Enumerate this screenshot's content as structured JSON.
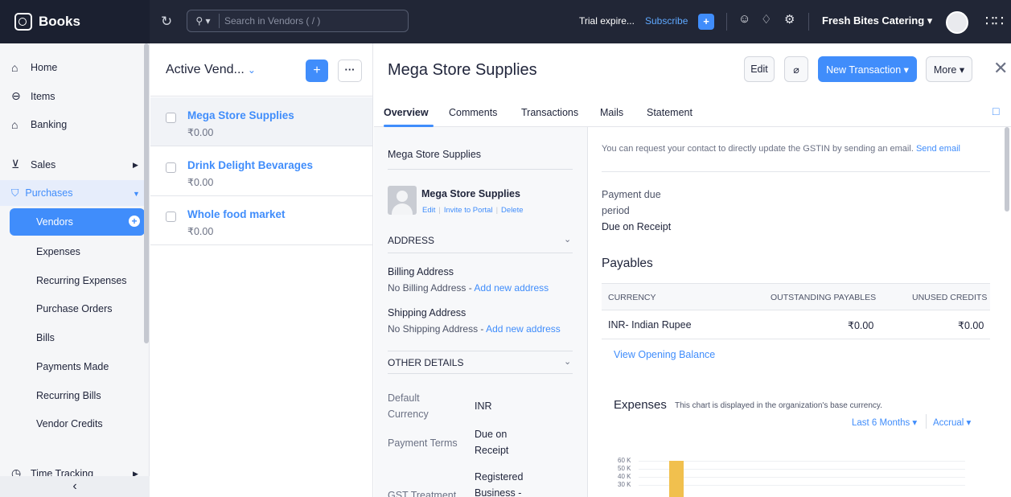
{
  "topbar": {
    "app_name": "Books",
    "search_placeholder": "Search in Vendors ( / )",
    "trial_text": "Trial expire...",
    "subscribe_label": "Subscribe",
    "org_name": "Fresh Bites Catering",
    "icons": [
      "books-logo-icon",
      "refresh-icon",
      "search-icon",
      "plus-icon",
      "users-icon",
      "bell-icon",
      "settings-icon",
      "app-grid-icon"
    ]
  },
  "sidebar": {
    "home": "Home",
    "items": "Items",
    "banking": "Banking",
    "sales": "Sales",
    "purchases": "Purchases",
    "vendors": "Vendors",
    "expenses": "Expenses",
    "recurring_expenses": "Recurring Expenses",
    "purchase_orders": "Purchase Orders",
    "bills": "Bills",
    "payments_made": "Payments Made",
    "recurring_bills": "Recurring Bills",
    "vendor_credits": "Vendor Credits",
    "time_tracking": "Time Tracking",
    "collapse": "‹"
  },
  "list": {
    "title": "Active Vend...",
    "vendors": [
      {
        "name": "Mega Store Supplies",
        "amount": "₹0.00"
      },
      {
        "name": "Drink Delight Bevarages",
        "amount": "₹0.00"
      },
      {
        "name": "Whole food market",
        "amount": "₹0.00"
      }
    ]
  },
  "detail": {
    "title": "Mega Store Supplies",
    "buttons": {
      "edit": "Edit",
      "attach": "⌀",
      "new_transaction": "New Transaction ▾",
      "more": "More ▾"
    },
    "tabs": [
      "Overview",
      "Comments",
      "Transactions",
      "Mails",
      "Statement"
    ],
    "left": {
      "vendor_name": "Mega Store Supplies",
      "contact_name": "Mega Store Supplies",
      "link_edit": "Edit",
      "link_invite": "Invite to Portal",
      "link_delete": "Delete",
      "address_heading": "ADDRESS",
      "billing_label": "Billing Address",
      "billing_value": "No Billing Address - ",
      "billing_link": "Add new address",
      "shipping_label": "Shipping Address",
      "shipping_value": "No Shipping Address - ",
      "shipping_link": "Add new address",
      "other_heading": "OTHER DETAILS",
      "default_currency_label": "Default Currency",
      "default_currency_value": "INR",
      "payment_terms_label": "Payment Terms",
      "payment_terms_value": "Due on Receipt",
      "gst_label": "GST Treatment",
      "gst_value": "Registered Business -"
    },
    "right": {
      "gstin_note": "You can request your contact to directly update the GSTIN by sending an email. ",
      "gstin_link": "Send email",
      "payment_due_label": "Payment due",
      "payment_due_label2": "period",
      "payment_due_value": "Due on Receipt",
      "payables_heading": "Payables",
      "col_currency": "CURRENCY",
      "col_outstanding": "OUTSTANDING PAYABLES",
      "col_unused": "UNUSED CREDITS",
      "row_currency": "INR- Indian Rupee",
      "row_outstanding": "₹0.00",
      "row_unused": "₹0.00",
      "opening_balance_link": "View Opening Balance",
      "expenses_title": "Expenses",
      "expenses_note": "This chart is displayed in the organization's base currency.",
      "period_select": "Last 6 Months ▾",
      "basis_select": "Accrual ▾",
      "y_ticks": [
        "60 K",
        "50 K",
        "40 K",
        "30 K"
      ]
    }
  }
}
